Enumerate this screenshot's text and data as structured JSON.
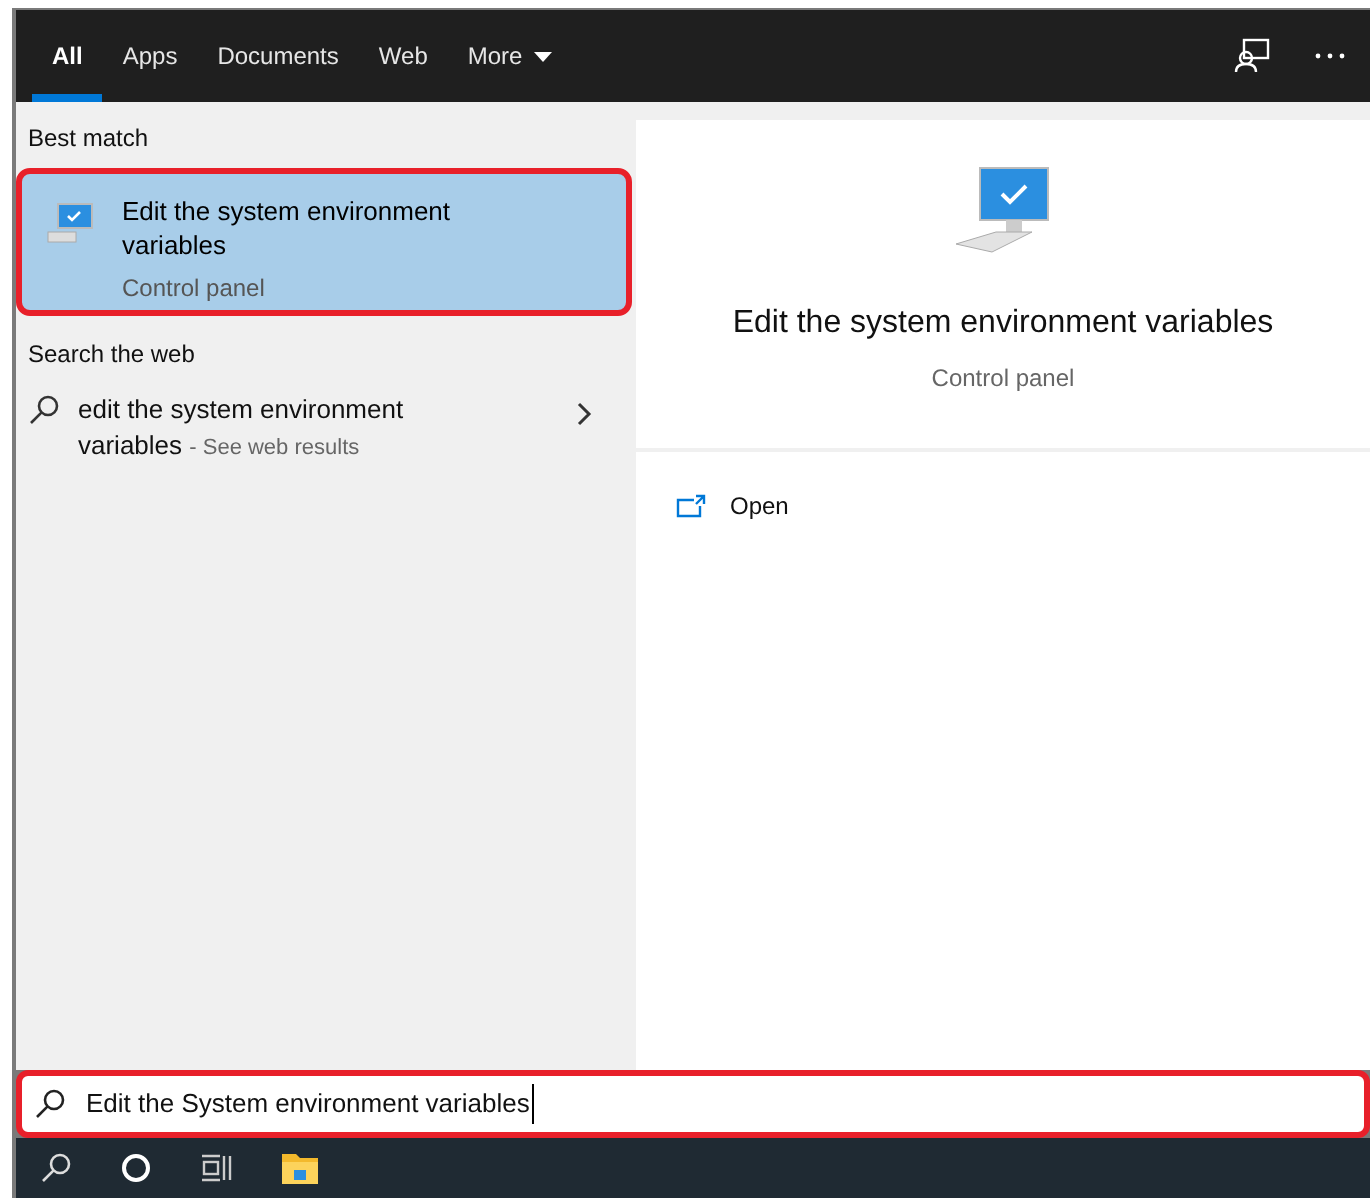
{
  "tabs": [
    {
      "label": "All",
      "selected": true
    },
    {
      "label": "Apps",
      "selected": false
    },
    {
      "label": "Documents",
      "selected": false
    },
    {
      "label": "Web",
      "selected": false
    },
    {
      "label": "More",
      "selected": false,
      "dropdown": true
    }
  ],
  "best_match": {
    "heading": "Best match",
    "title": "Edit the system environment variables",
    "subtitle": "Control panel",
    "selected": true,
    "highlighted": true
  },
  "web": {
    "heading": "Search the web",
    "query": "edit the system environment variables",
    "suffix": "- See web results"
  },
  "preview": {
    "title": "Edit the system environment variables",
    "subtitle": "Control panel",
    "actions": [
      {
        "label": "Open"
      }
    ]
  },
  "search": {
    "value": "Edit the System environment variables",
    "highlighted": true
  }
}
